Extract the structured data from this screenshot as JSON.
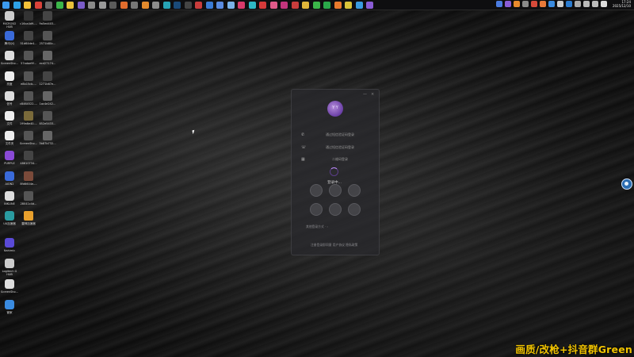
{
  "taskbar": {
    "left_icons": [
      {
        "name": "windows-start-icon",
        "color": "#3c9bf0"
      },
      {
        "name": "edge-browser-icon",
        "color": "#2ea1e6"
      },
      {
        "name": "file-explorer-icon",
        "color": "#f3c13a"
      },
      {
        "name": "app-red-icon",
        "color": "#d9423a"
      },
      {
        "name": "app-monitor-icon",
        "color": "#6b6b6b"
      },
      {
        "name": "app-green-icon",
        "color": "#3bb54a"
      },
      {
        "name": "app-chrome-icon",
        "color": "#e8c13a"
      },
      {
        "name": "app-purple-icon",
        "color": "#7a5cc9"
      },
      {
        "name": "app-settings-icon",
        "color": "#8a8a8a"
      },
      {
        "name": "app-gear-icon",
        "color": "#9a9a9a"
      },
      {
        "name": "app-circle-icon",
        "color": "#5b5b5b"
      },
      {
        "name": "app-g-icon",
        "color": "#e06c2d"
      },
      {
        "name": "app-text-icon",
        "color": "#777777"
      },
      {
        "name": "app-orange-icon",
        "color": "#e38a2d"
      },
      {
        "name": "app-gray-icon",
        "color": "#8c8c8c"
      },
      {
        "name": "app-teal-icon",
        "color": "#27a3b5"
      },
      {
        "name": "app-steam-icon",
        "color": "#1a4a78"
      },
      {
        "name": "app-dark-icon",
        "color": "#444444"
      },
      {
        "name": "app-red2-icon",
        "color": "#c83c3c"
      },
      {
        "name": "app-blue-icon",
        "color": "#3a7bd5"
      },
      {
        "name": "app-blue2-icon",
        "color": "#5a8be0"
      },
      {
        "name": "app-lightblue-icon",
        "color": "#7ab2e8"
      },
      {
        "name": "app-pink-icon",
        "color": "#d83a6b"
      },
      {
        "name": "app-cyan-icon",
        "color": "#2fb8c5"
      },
      {
        "name": "app-w-icon",
        "color": "#d63a3a"
      },
      {
        "name": "app-bilibili-icon",
        "color": "#e05a8a"
      },
      {
        "name": "app-magenta-icon",
        "color": "#c2357d"
      },
      {
        "name": "app-mail-icon",
        "color": "#c83c3c"
      },
      {
        "name": "app-folder-icon",
        "color": "#e0b53a"
      },
      {
        "name": "app-play-icon",
        "color": "#3bb54a"
      },
      {
        "name": "app-play2-icon",
        "color": "#2aa84a"
      },
      {
        "name": "app-orange2-icon",
        "color": "#e87a2d"
      },
      {
        "name": "app-lemon-icon",
        "color": "#d8c23a"
      },
      {
        "name": "app-circle2-icon",
        "color": "#3a9be0"
      },
      {
        "name": "app-active-purple-icon",
        "color": "#8a5cd6"
      }
    ],
    "tray_icons": [
      {
        "name": "tray-bluetooth-icon",
        "color": "#4a7be0"
      },
      {
        "name": "tray-purple-icon",
        "color": "#8a5cd6"
      },
      {
        "name": "tray-orange-icon",
        "color": "#e88a2d"
      },
      {
        "name": "tray-gray-icon",
        "color": "#8a8a8a"
      },
      {
        "name": "tray-red-icon",
        "color": "#d64a3a"
      },
      {
        "name": "tray-orange2-icon",
        "color": "#e87a3a"
      },
      {
        "name": "tray-blue-icon",
        "color": "#3a8be0"
      },
      {
        "name": "tray-white-icon",
        "color": "#cccccc"
      },
      {
        "name": "tray-blue2-icon",
        "color": "#2a7bd0"
      },
      {
        "name": "tray-up-icon",
        "color": "#aaaaaa"
      },
      {
        "name": "tray-network-icon",
        "color": "#bbbbbb"
      },
      {
        "name": "tray-volume-icon",
        "color": "#bbbbbb"
      },
      {
        "name": "tray-lang-icon",
        "color": "#dddddd"
      }
    ],
    "clock_time": "17:24",
    "clock_date": "2025/12/10"
  },
  "desktop_icons": [
    {
      "label": "MICROSO HUB",
      "color": "#cccccc",
      "col": 0,
      "row": 0
    },
    {
      "label": "c16ca4d9-...",
      "color": "#333333",
      "col": 1,
      "row": 0
    },
    {
      "label": "9a5ed403...",
      "color": "#444444",
      "col": 2,
      "row": 0
    },
    {
      "label": "腾讯QQ",
      "color": "#3a6ad9",
      "col": 0,
      "row": 1
    },
    {
      "label": "51d64de4...",
      "color": "#444444",
      "col": 1,
      "row": 1
    },
    {
      "label": "2571b80c...",
      "color": "#555555",
      "col": 2,
      "row": 1
    },
    {
      "label": "ScreenSho...",
      "color": "#dddddd",
      "col": 0,
      "row": 2
    },
    {
      "label": "57adae9f...",
      "color": "#555555",
      "col": 1,
      "row": 2
    },
    {
      "label": "ecd27174...",
      "color": "#666666",
      "col": 2,
      "row": 2
    },
    {
      "label": "亮度",
      "color": "#eeeeee",
      "col": 0,
      "row": 3
    },
    {
      "label": "e8b15cb-...",
      "color": "#555555",
      "col": 1,
      "row": 3
    },
    {
      "label": "1271b67e...",
      "color": "#444444",
      "col": 2,
      "row": 3
    },
    {
      "label": "信号",
      "color": "#dddddd",
      "col": 0,
      "row": 4
    },
    {
      "label": "c8464522-...",
      "color": "#555555",
      "col": 1,
      "row": 4
    },
    {
      "label": "1ac4e242...",
      "color": "#666666",
      "col": 2,
      "row": 4
    },
    {
      "label": "文件",
      "color": "#eeeeee",
      "col": 0,
      "row": 5
    },
    {
      "label": "199a6e40-...",
      "color": "#7a6a3a",
      "col": 1,
      "row": 5
    },
    {
      "label": "852e5433...",
      "color": "#555555",
      "col": 2,
      "row": 5
    },
    {
      "label": "文件夹",
      "color": "#eeeeee",
      "col": 0,
      "row": 6
    },
    {
      "label": "ScreenSho...",
      "color": "#555555",
      "col": 1,
      "row": 6
    },
    {
      "label": "3b87b732...",
      "color": "#666666",
      "col": 2,
      "row": 6
    },
    {
      "label": "PURPLE",
      "color": "#8a4ad6",
      "col": 0,
      "row": 7
    },
    {
      "label": "48610734...",
      "color": "#444444",
      "col": 1,
      "row": 7
    },
    {
      "label": "AION2",
      "color": "#3a6ad9",
      "col": 0,
      "row": 8
    },
    {
      "label": "8fd6604e-...",
      "color": "#7a4a3a",
      "col": 1,
      "row": 8
    },
    {
      "label": "INKLINE",
      "color": "#dddddd",
      "col": 0,
      "row": 9
    },
    {
      "label": "28041c4d...",
      "color": "#555555",
      "col": 1,
      "row": 9
    },
    {
      "label": "UU加速器",
      "color": "#2a9ba0",
      "col": 0,
      "row": 10
    },
    {
      "label": "雷神加速器",
      "color": "#e8a02d",
      "col": 1,
      "row": 10
    },
    {
      "label": "Nahimic",
      "color": "#5a4ad6",
      "col": 0,
      "row": 11
    },
    {
      "label": "Logitech G HUB",
      "color": "#cccccc",
      "col": 0,
      "row": 12
    },
    {
      "label": "ScreenSho...",
      "color": "#dddddd",
      "col": 0,
      "row": 13
    },
    {
      "label": "管家",
      "color": "#3a8be0",
      "col": 0,
      "row": 14
    }
  ],
  "login_window": {
    "minimize_glyph": "—",
    "close_glyph": "×",
    "logo_text": "Y Y",
    "options": [
      {
        "icon": "✆",
        "label": "通过短信验证码登录"
      },
      {
        "icon": "☏",
        "label": "通过短信验证码登录"
      },
      {
        "icon": "▦",
        "label": "二维码登录"
      }
    ],
    "status": "登录中...",
    "bottom_link_1": "其他登录方式  ·  ›",
    "bottom_link_2": "注册登录即同意  用户协议  隐私政策"
  },
  "watermark": "画质/改枪+抖音群Green"
}
